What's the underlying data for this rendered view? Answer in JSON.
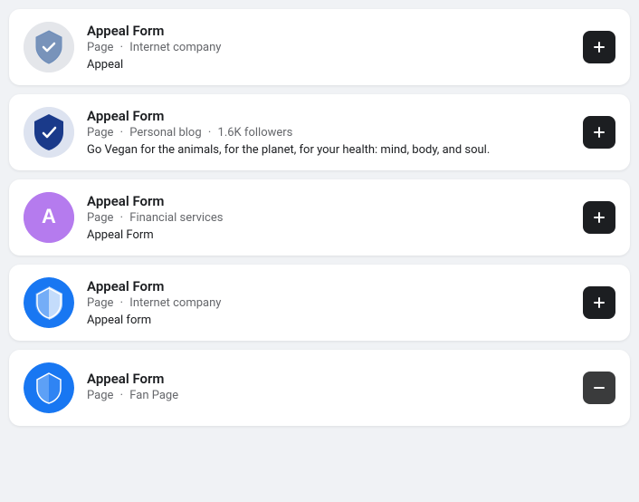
{
  "items": [
    {
      "id": 1,
      "title": "Appeal Form",
      "meta_type": "Page",
      "meta_category": "Internet company",
      "followers": null,
      "description": "Appeal",
      "avatar_type": "shield_gray_blue",
      "add_button_label": "+"
    },
    {
      "id": 2,
      "title": "Appeal Form",
      "meta_type": "Page",
      "meta_category": "Personal blog",
      "followers": "1.6K followers",
      "description": "Go Vegan for the animals, for the planet, for your health: mind, body, and soul.",
      "avatar_type": "shield_dark_blue",
      "add_button_label": "+"
    },
    {
      "id": 3,
      "title": "Appeal Form",
      "meta_type": "Page",
      "meta_category": "Financial services",
      "followers": null,
      "description": "Appeal Form",
      "avatar_type": "letter_A",
      "add_button_label": "+"
    },
    {
      "id": 4,
      "title": "Appeal Form",
      "meta_type": "Page",
      "meta_category": "Internet company",
      "followers": null,
      "description": "Appeal form",
      "avatar_type": "shield_blue_white",
      "add_button_label": "+"
    },
    {
      "id": 5,
      "title": "Appeal Form",
      "meta_type": "Page",
      "meta_category": "Fan Page",
      "followers": null,
      "description": null,
      "avatar_type": "shield_blue_white2",
      "add_button_label": "+"
    }
  ]
}
